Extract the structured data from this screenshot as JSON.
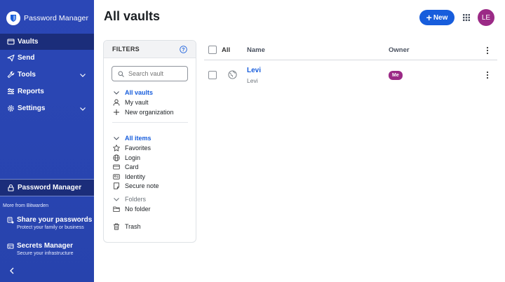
{
  "app": {
    "brand": "Password Manager",
    "page_title": "All vaults"
  },
  "sidebar": {
    "items": [
      {
        "label": "Vaults",
        "icon": "vault-icon",
        "active": true
      },
      {
        "label": "Send",
        "icon": "send-icon"
      },
      {
        "label": "Tools",
        "icon": "wrench-icon",
        "expandable": true
      },
      {
        "label": "Reports",
        "icon": "reports-icon"
      },
      {
        "label": "Settings",
        "icon": "gear-icon",
        "expandable": true
      }
    ],
    "product_switcher": {
      "label": "Password Manager",
      "icon": "lock-icon"
    },
    "more_from": "More from Bitwarden",
    "products": [
      {
        "title": "Share your passwords",
        "subtitle": "Protect your family or business",
        "icon": "share-icon"
      },
      {
        "title": "Secrets Manager",
        "subtitle": "Secure your infrastructure",
        "icon": "secrets-icon"
      }
    ]
  },
  "header": {
    "new_label": "New",
    "avatar_initials": "LE",
    "avatar_color": "#9b2a86",
    "accent_color": "#175ddc"
  },
  "filters": {
    "title": "FILTERS",
    "search_placeholder": "Search vault",
    "vaults": [
      {
        "label": "All vaults",
        "icon": "chevron-down-icon",
        "selected": true
      },
      {
        "label": "My vault",
        "icon": "user-icon"
      },
      {
        "label": "New organization",
        "icon": "plus-icon"
      }
    ],
    "types": [
      {
        "label": "All items",
        "icon": "chevron-down-icon",
        "selected": true
      },
      {
        "label": "Favorites",
        "icon": "star-icon"
      },
      {
        "label": "Login",
        "icon": "globe-icon"
      },
      {
        "label": "Card",
        "icon": "card-icon"
      },
      {
        "label": "Identity",
        "icon": "id-card-icon"
      },
      {
        "label": "Secure note",
        "icon": "note-icon"
      }
    ],
    "folders": [
      {
        "label": "Folders",
        "icon": "chevron-down-icon",
        "muted": true
      },
      {
        "label": "No folder",
        "icon": "folder-icon"
      }
    ],
    "trash": {
      "label": "Trash",
      "icon": "trash-icon"
    }
  },
  "table": {
    "headers": {
      "all": "All",
      "name": "Name",
      "owner": "Owner"
    },
    "rows": [
      {
        "name": "Levi",
        "subtitle": "Levi",
        "owner": "Me",
        "icon": "globe-icon"
      }
    ]
  }
}
